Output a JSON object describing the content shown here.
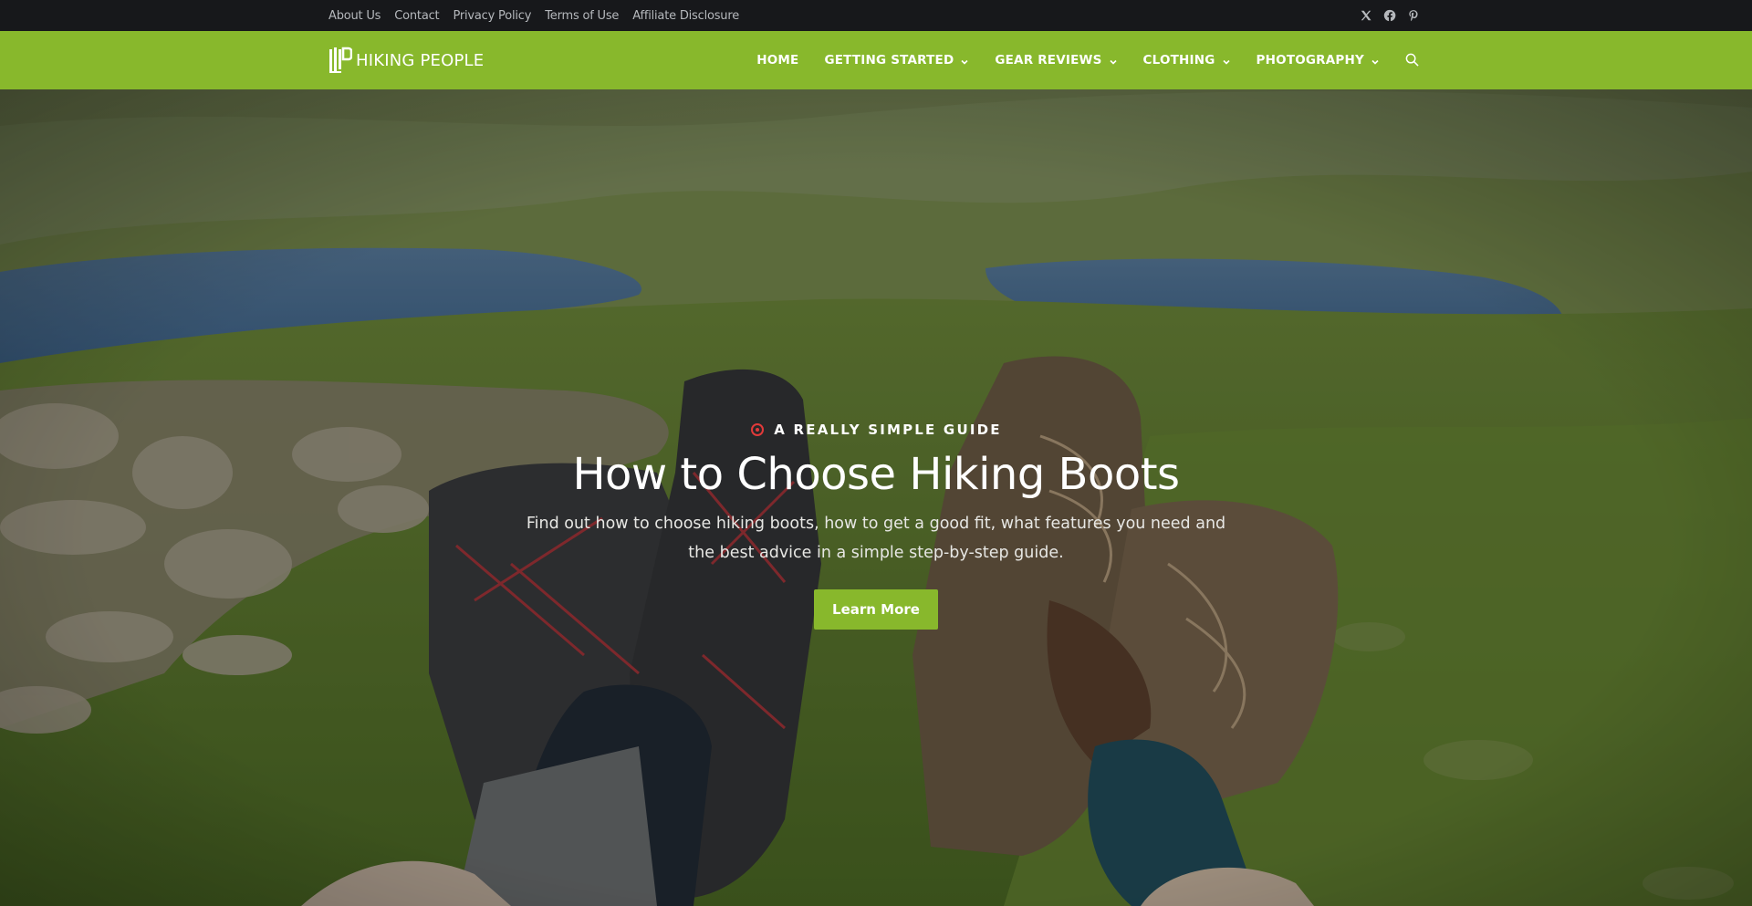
{
  "topbar": {
    "links": [
      "About Us",
      "Contact",
      "Privacy Policy",
      "Terms of Use",
      "Affiliate Disclosure"
    ],
    "social_icons": [
      "x-icon",
      "facebook-icon",
      "pinterest-icon"
    ]
  },
  "nav": {
    "logo_text": "HIKING PEOPLE",
    "items": [
      {
        "label": "HOME",
        "has_dropdown": false
      },
      {
        "label": "GETTING STARTED",
        "has_dropdown": true
      },
      {
        "label": "GEAR REVIEWS",
        "has_dropdown": true
      },
      {
        "label": "CLOTHING",
        "has_dropdown": true
      },
      {
        "label": "PHOTOGRAPHY",
        "has_dropdown": true
      }
    ],
    "search_icon": "search-icon"
  },
  "hero": {
    "eyebrow": "A REALLY SIMPLE GUIDE",
    "title": "How to Choose Hiking Boots",
    "description": "Find out how to choose hiking boots, how to get a good fit, what features you need and the best advice in a simple step-by-step guide.",
    "button_label": "Learn More"
  },
  "colors": {
    "topbar_bg": "#17181b",
    "brand_green": "#88b82c",
    "accent_red": "#e23a3a"
  }
}
